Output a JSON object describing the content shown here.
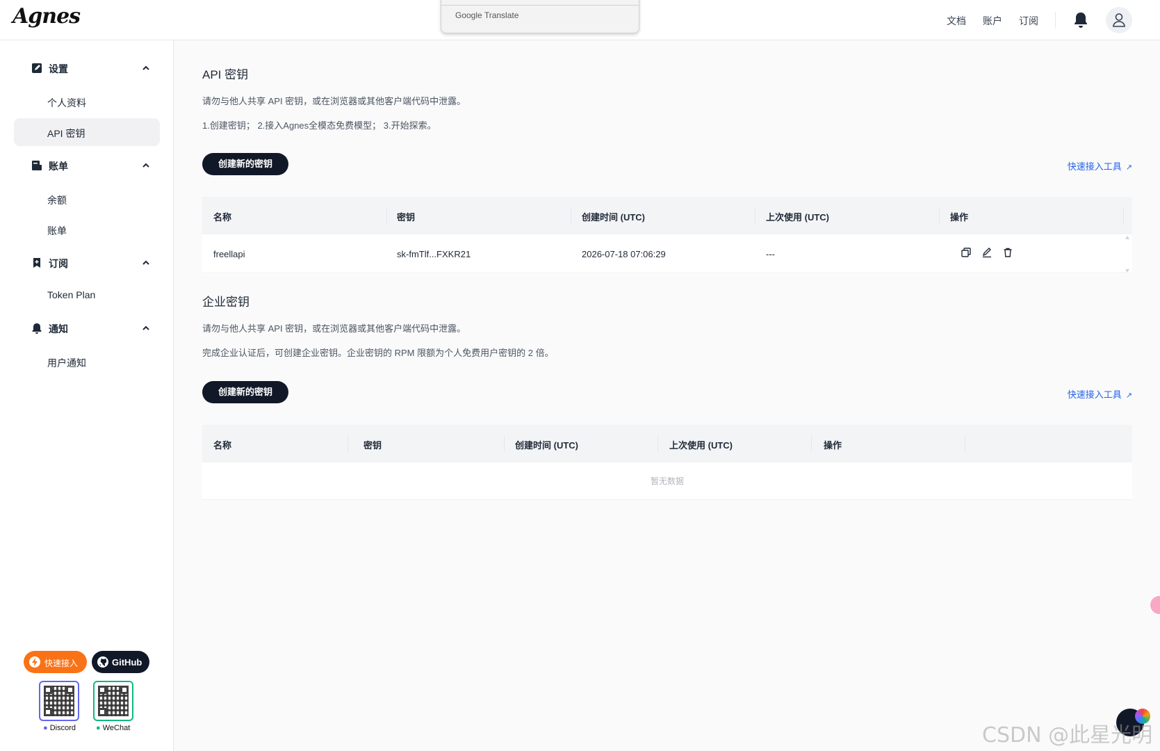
{
  "header": {
    "logo": "Agnes",
    "translate_popup": "Google Translate",
    "nav": [
      "文档",
      "账户",
      "订阅"
    ]
  },
  "sidebar": {
    "groups": [
      {
        "label": "设置",
        "icon": "edit-doc-icon",
        "items": [
          "个人资料",
          "API 密钥"
        ]
      },
      {
        "label": "账单",
        "icon": "bill-icon",
        "items": [
          "余额",
          "账单"
        ]
      },
      {
        "label": "订阅",
        "icon": "bookmark-add-icon",
        "items": [
          "Token Plan"
        ]
      },
      {
        "label": "通知",
        "icon": "bell-icon",
        "items": [
          "用户通知"
        ]
      }
    ],
    "active_item": "API 密钥",
    "quick_button": "快速接入",
    "github_button": "GitHub",
    "qr": [
      {
        "label": "Discord"
      },
      {
        "label": "WeChat"
      }
    ]
  },
  "api_keys": {
    "title": "API 密钥",
    "desc1": "请勿与他人共享 API 密钥，或在浏览器或其他客户端代码中泄露。",
    "desc2": "1.创建密钥； 2.接入Agnes全模态免费模型； 3.开始探索。",
    "create_button": "创建新的密钥",
    "quick_link": "快速接入工具",
    "columns": [
      "名称",
      "密钥",
      "创建时间 (UTC)",
      "上次使用 (UTC)",
      "操作"
    ],
    "rows": [
      {
        "name": "freellapi",
        "key": "sk-fmTlf...FXKR21",
        "created": "2026-07-18 07:06:29",
        "last_used": "---"
      }
    ]
  },
  "enterprise_keys": {
    "title": "企业密钥",
    "desc1": "请勿与他人共享 API 密钥，或在浏览器或其他客户端代码中泄露。",
    "desc2": "完成企业认证后，可创建企业密钥。企业密钥的 RPM 限额为个人免费用户密钥的 2 倍。",
    "create_button": "创建新的密钥",
    "quick_link": "快速接入工具",
    "columns": [
      "名称",
      "密钥",
      "创建时间 (UTC)",
      "上次使用 (UTC)",
      "操作"
    ],
    "empty_text": "暂无数据"
  },
  "watermark": "CSDN @此星光明",
  "colors": {
    "accent_dark": "#111827",
    "link_blue": "#2563eb",
    "quick_orange": "#f97316"
  }
}
